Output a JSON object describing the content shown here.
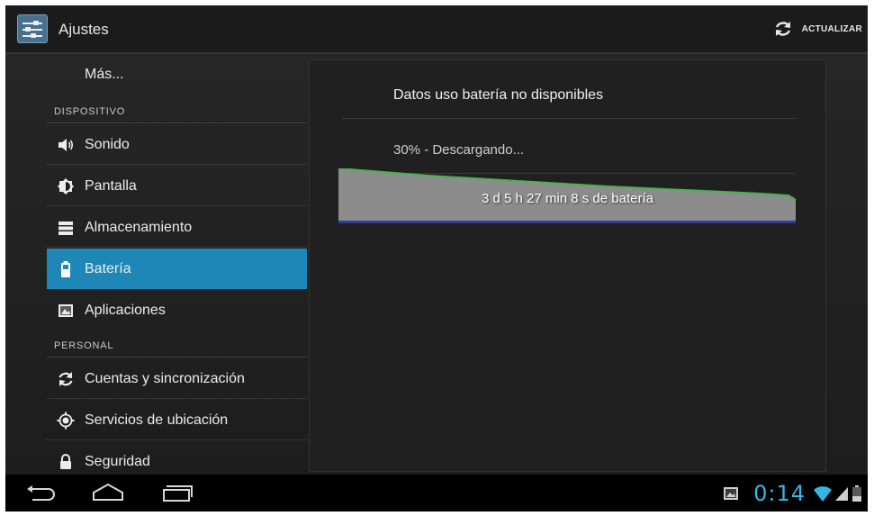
{
  "actionbar": {
    "title": "Ajustes",
    "app_icon": "settings-sliders-icon",
    "refresh_icon": "refresh-icon",
    "refresh_label": "ACTUALIZAR"
  },
  "sidebar": {
    "more_label": "Más...",
    "section_device": "DISPOSITIVO",
    "section_personal": "PERSONAL",
    "items": [
      {
        "label": "Sonido",
        "icon": "volume-icon"
      },
      {
        "label": "Pantalla",
        "icon": "brightness-icon"
      },
      {
        "label": "Almacenamiento",
        "icon": "storage-icon"
      },
      {
        "label": "Batería",
        "icon": "battery-icon",
        "selected": true
      },
      {
        "label": "Aplicaciones",
        "icon": "apps-icon"
      },
      {
        "label": "Cuentas y sincronización",
        "icon": "sync-icon"
      },
      {
        "label": "Servicios de ubicación",
        "icon": "location-icon"
      },
      {
        "label": "Seguridad",
        "icon": "lock-icon"
      }
    ]
  },
  "battery": {
    "title": "Datos uso batería no disponibles",
    "status": "30% - Descargando...",
    "graph_label": "3 d 5 h 27 min 8 s de batería"
  },
  "system_bar": {
    "clock": "0:14",
    "icons": [
      "back-icon",
      "home-icon",
      "recent-apps-icon",
      "gallery-notification-icon",
      "wifi-icon",
      "signal-icon",
      "battery-status-icon"
    ]
  },
  "colors": {
    "accent": "#1e87b8",
    "clock": "#33b5e5",
    "graph_line": "#4caf50",
    "graph_base": "#2c3e9e"
  }
}
